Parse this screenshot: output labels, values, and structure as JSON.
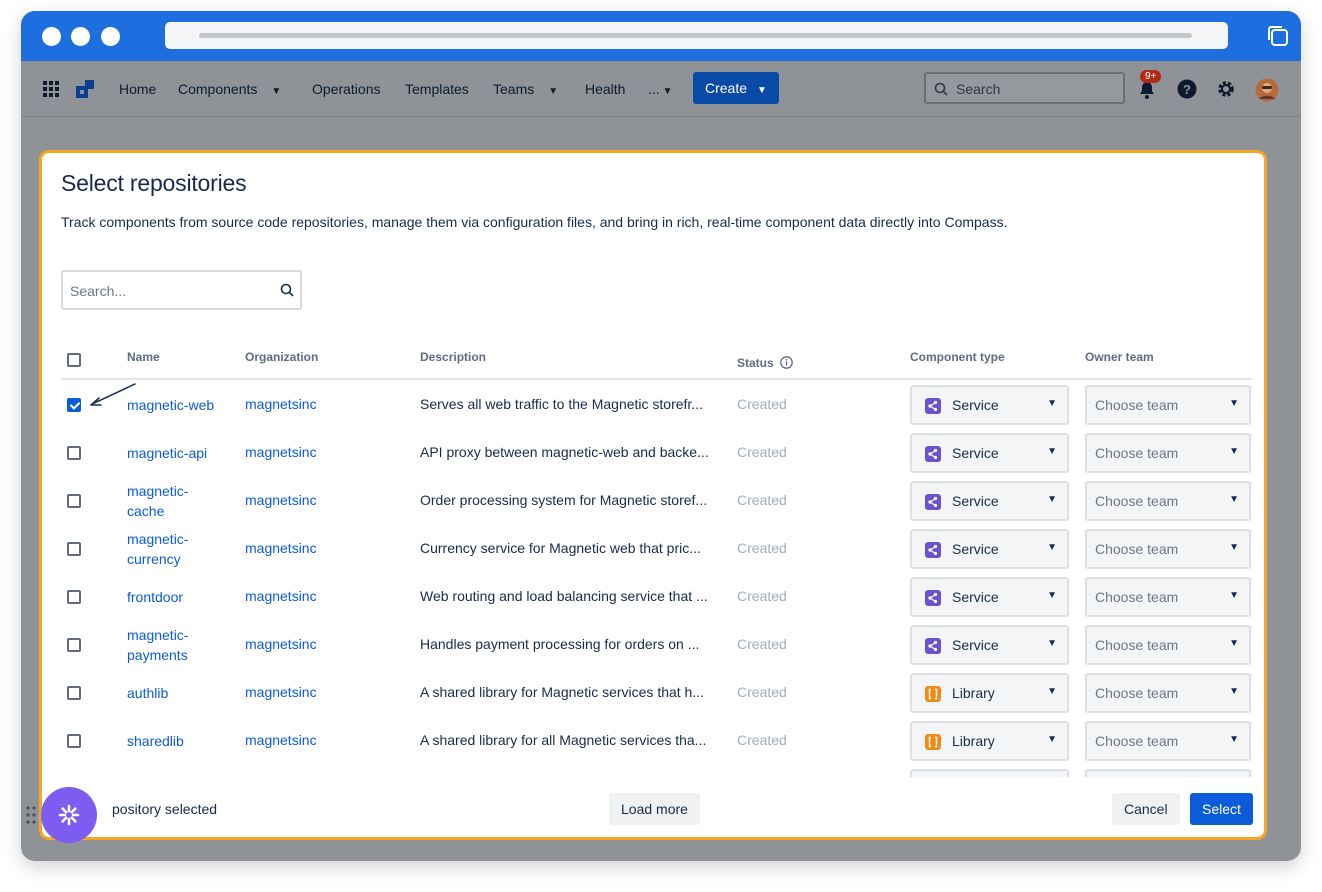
{
  "nav": {
    "items": [
      {
        "label": "Home"
      },
      {
        "label": "Components"
      },
      {
        "label": "Operations"
      },
      {
        "label": "Templates"
      },
      {
        "label": "Teams"
      },
      {
        "label": "Health"
      },
      {
        "label": "..."
      }
    ],
    "create_label": "Create",
    "search_placeholder": "Search",
    "notifications_badge": "9+"
  },
  "modal": {
    "title": "Select repositories",
    "description": "Track components from source code repositories, manage them via configuration files, and bring in rich, real-time component data directly into Compass.",
    "search_placeholder": "Search...",
    "columns": {
      "name": "Name",
      "organization": "Organization",
      "description": "Description",
      "status": "Status",
      "component_type": "Component type",
      "owner_team": "Owner team"
    },
    "rows": [
      {
        "name": "magnetic-web",
        "org": "magnetsinc",
        "desc": "Serves all web traffic to the Magnetic storefr...",
        "status": "Created",
        "type": "Service",
        "team": "Choose team",
        "checked": true
      },
      {
        "name": "magnetic-api",
        "org": "magnetsinc",
        "desc": "API proxy between magnetic-web and backe...",
        "status": "Created",
        "type": "Service",
        "team": "Choose team",
        "checked": false
      },
      {
        "name": "magnetic-cache",
        "org": "magnetsinc",
        "desc": "Order processing system for Magnetic storef...",
        "status": "Created",
        "type": "Service",
        "team": "Choose team",
        "checked": false
      },
      {
        "name": "magnetic-currency",
        "org": "magnetsinc",
        "desc": "Currency service for Magnetic web that pric...",
        "status": "Created",
        "type": "Service",
        "team": "Choose team",
        "checked": false
      },
      {
        "name": "frontdoor",
        "org": "magnetsinc",
        "desc": "Web routing and load balancing service that ...",
        "status": "Created",
        "type": "Service",
        "team": "Choose team",
        "checked": false
      },
      {
        "name": "magnetic-payments",
        "org": "magnetsinc",
        "desc": "Handles payment processing for orders on ...",
        "status": "Created",
        "type": "Service",
        "team": "Choose team",
        "checked": false
      },
      {
        "name": "authlib",
        "org": "magnetsinc",
        "desc": "A shared library for Magnetic services that h...",
        "status": "Created",
        "type": "Library",
        "team": "Choose team",
        "checked": false
      },
      {
        "name": "sharedlib",
        "org": "magnetsinc",
        "desc": "A shared library for all Magnetic services tha...",
        "status": "Created",
        "type": "Library",
        "team": "Choose team",
        "checked": false
      }
    ],
    "footer": {
      "selected_text": "pository selected",
      "load_more_label": "Load more",
      "cancel_label": "Cancel",
      "select_label": "Select"
    }
  },
  "colors": {
    "titlebar": "#1d6fe0",
    "modal_border": "#f5a623",
    "link": "#0c5bd9",
    "service_icon": "#6d52cf",
    "library_icon": "#f18d13",
    "assistant_fab": "#7c5cf1"
  }
}
